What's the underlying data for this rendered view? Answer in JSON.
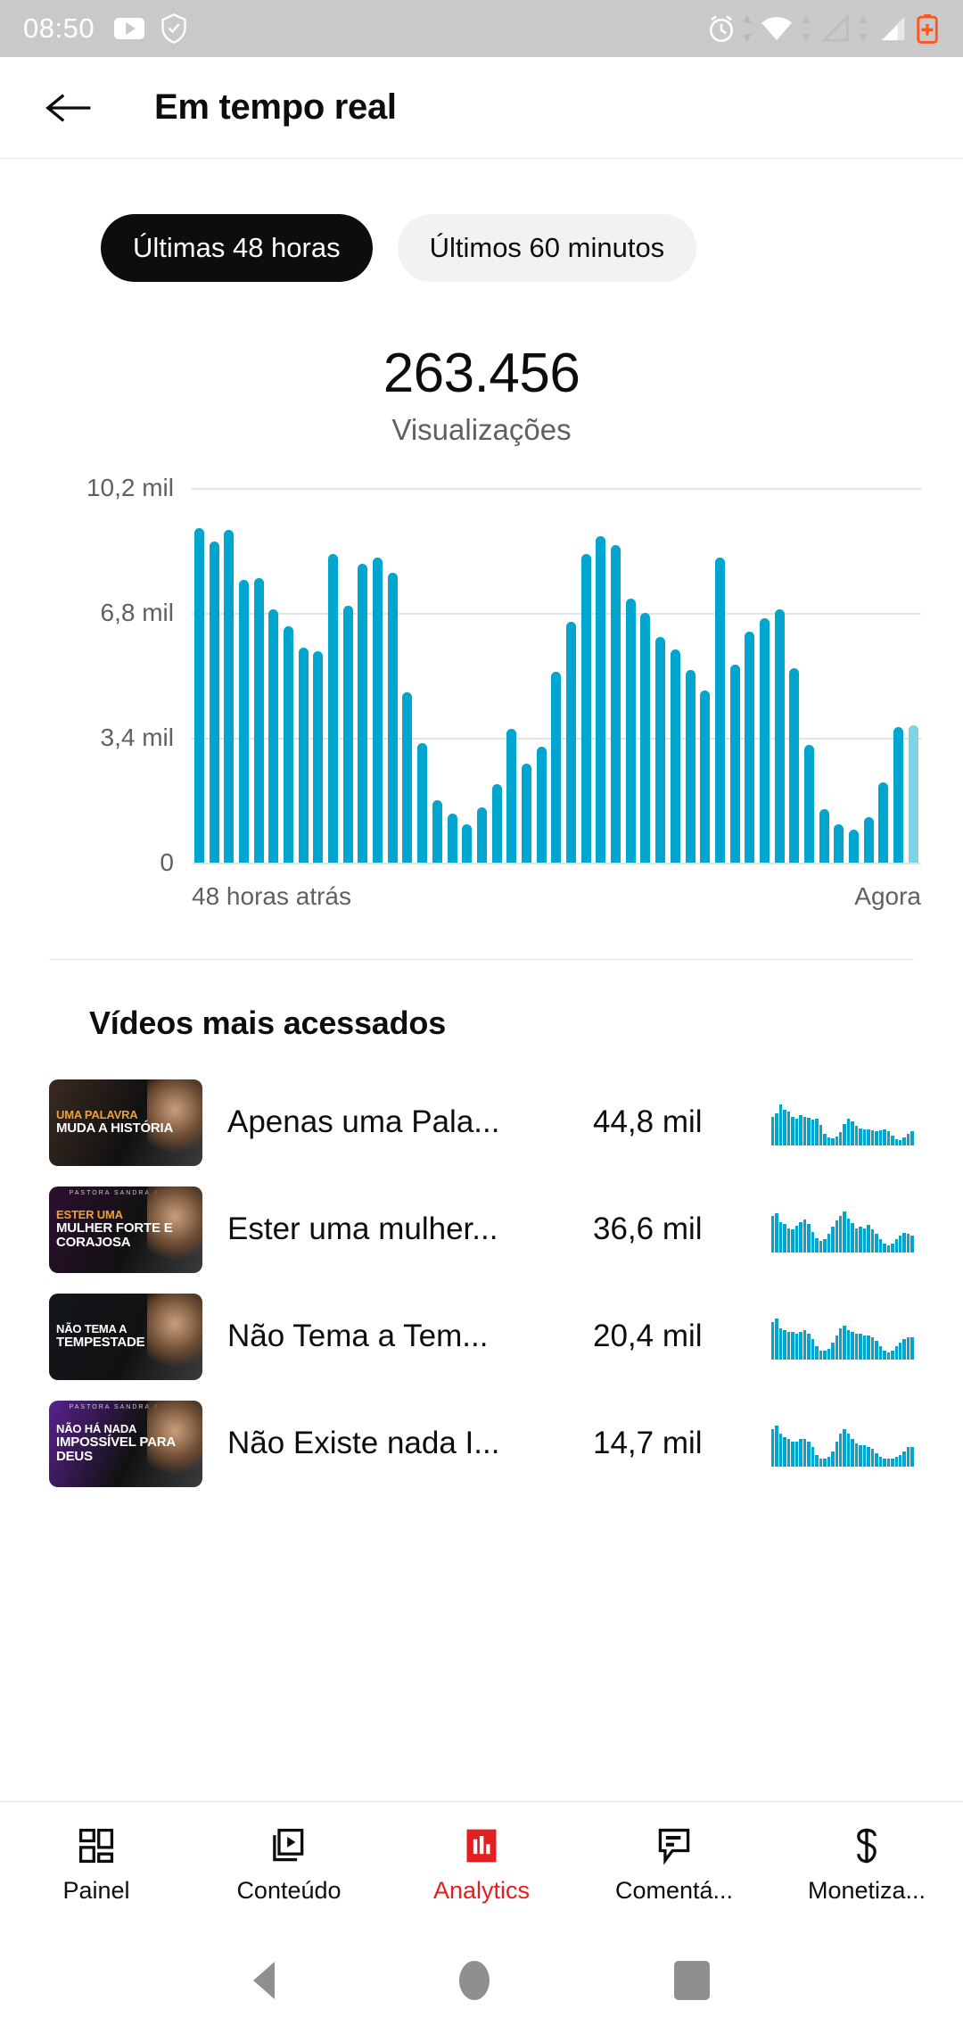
{
  "status_bar": {
    "clock": "08:50",
    "left_icons": [
      "youtube-badge-icon",
      "shield-check-icon"
    ],
    "right_icons": [
      "alarm-icon",
      "wifi-icon",
      "signal-empty-icon",
      "signal-full-icon",
      "battery-charging-icon"
    ],
    "background": "#c9c9c9"
  },
  "app_bar": {
    "back_label": "back-arrow",
    "title": "Em tempo real"
  },
  "chips": [
    {
      "label": "Últimas 48 horas",
      "selected": true
    },
    {
      "label": "Últimos 60 minutos",
      "selected": false
    }
  ],
  "metric": {
    "value": "263.456",
    "label": "Visualizações"
  },
  "chart_data": {
    "type": "bar",
    "title": "",
    "subtitle": "",
    "xlabel": "",
    "ylabel": "",
    "axis_start_label": "48 horas atrás",
    "axis_end_label": "Agora",
    "ytick_labels": [
      "10,2 mil",
      "6,8 mil",
      "3,4 mil",
      "0"
    ],
    "ytick_values": [
      10200,
      6800,
      3400,
      0
    ],
    "ylim": [
      0,
      10200
    ],
    "grid": true,
    "legend": "none",
    "bar_color": "#00a6cd",
    "partial_bar_color": "#80d2e6",
    "partial_last_bar": true,
    "categories": [
      "h1",
      "h2",
      "h3",
      "h4",
      "h5",
      "h6",
      "h7",
      "h8",
      "h9",
      "h10",
      "h11",
      "h12",
      "h13",
      "h14",
      "h15",
      "h16",
      "h17",
      "h18",
      "h19",
      "h20",
      "h21",
      "h22",
      "h23",
      "h24",
      "h25",
      "h26",
      "h27",
      "h28",
      "h29",
      "h30",
      "h31",
      "h32",
      "h33",
      "h34",
      "h35",
      "h36",
      "h37",
      "h38",
      "h39",
      "h40",
      "h41",
      "h42",
      "h43",
      "h44",
      "h45",
      "h46",
      "h47",
      "h48"
    ],
    "values": [
      9100,
      8750,
      9050,
      7700,
      7750,
      6900,
      6450,
      5850,
      5750,
      8400,
      7000,
      8150,
      8300,
      7900,
      4650,
      3250,
      1700,
      1350,
      1050,
      1500,
      2150,
      3650,
      2700,
      3150,
      5200,
      6550,
      8400,
      8900,
      8650,
      7200,
      6800,
      6150,
      5800,
      5250,
      4700,
      8300,
      5400,
      6300,
      6650,
      6900,
      5300,
      3200,
      1450,
      1050,
      900,
      1250,
      2200,
      3700,
      3750
    ],
    "partial_value": 3750
  },
  "videos_section": {
    "title": "Vídeos mais acessados",
    "rows": [
      {
        "title": "Apenas uma Pala...",
        "views": "44,8 mil",
        "thumbnail": {
          "line1": "UMA PALAVRA",
          "line2": "MUDA A HISTÓRIA",
          "line1_color": "#f0a030",
          "bg": "#3a2a20",
          "tiny": ""
        },
        "sparkline": [
          62,
          70,
          88,
          76,
          72,
          62,
          58,
          66,
          62,
          60,
          56,
          58,
          44,
          26,
          18,
          16,
          20,
          28,
          46,
          58,
          52,
          42,
          36,
          34,
          34,
          32,
          30,
          32,
          34,
          30,
          22,
          14,
          12,
          18,
          26,
          30
        ]
      },
      {
        "title": "Ester uma mulher...",
        "views": "36,6 mil",
        "thumbnail": {
          "line1": "ESTER UMA",
          "line2": "MULHER FORTE E CORAJOSA",
          "line1_color": "#f0a030",
          "bg": "#2d1030",
          "tiny": "PASTORA SANDRA ALVES"
        },
        "sparkline": [
          72,
          76,
          60,
          56,
          48,
          46,
          52,
          60,
          64,
          56,
          40,
          28,
          22,
          26,
          36,
          50,
          62,
          72,
          80,
          66,
          58,
          48,
          50,
          48,
          54,
          46,
          36,
          26,
          18,
          14,
          18,
          26,
          34,
          38,
          36,
          34
        ]
      },
      {
        "title": "Não Tema a Tem...",
        "views": "20,4 mil",
        "thumbnail": {
          "line1": "NÃO TEMA A",
          "line2": "TEMPESTADE",
          "line1_color": "#ffffff",
          "bg": "#12161c",
          "tiny": ""
        },
        "sparkline": [
          40,
          44,
          34,
          32,
          30,
          30,
          28,
          30,
          32,
          28,
          22,
          14,
          10,
          10,
          12,
          18,
          26,
          34,
          36,
          32,
          30,
          28,
          28,
          26,
          26,
          24,
          20,
          14,
          10,
          8,
          10,
          14,
          18,
          22,
          24,
          24
        ]
      },
      {
        "title": "Não Existe nada I...",
        "views": "14,7 mil",
        "thumbnail": {
          "line1": "NÃO HÁ NADA",
          "line2": "IMPOSSÍVEL PARA DEUS",
          "line1_color": "#ffffff",
          "bg": "#5a2190",
          "tiny": "PASTORA SANDRA ALVES"
        },
        "sparkline": [
          38,
          42,
          34,
          30,
          28,
          26,
          26,
          28,
          28,
          26,
          20,
          12,
          8,
          8,
          10,
          16,
          26,
          34,
          38,
          34,
          28,
          24,
          22,
          22,
          20,
          18,
          14,
          10,
          8,
          8,
          8,
          10,
          12,
          16,
          20,
          20
        ]
      }
    ]
  },
  "bottom_nav": {
    "active_color": "#e22020",
    "items": [
      {
        "label": "Painel",
        "icon": "dashboard-icon",
        "active": false
      },
      {
        "label": "Conteúdo",
        "icon": "video-play-icon",
        "active": false
      },
      {
        "label": "Analytics",
        "icon": "bar-chart-icon",
        "active": true
      },
      {
        "label": "Comentá...",
        "icon": "comment-icon",
        "active": false
      },
      {
        "label": "Monetiza...",
        "icon": "dollar-icon",
        "active": false
      }
    ]
  },
  "android_nav": {
    "items": [
      "back-triangle",
      "home-circle",
      "recents-square"
    ]
  }
}
